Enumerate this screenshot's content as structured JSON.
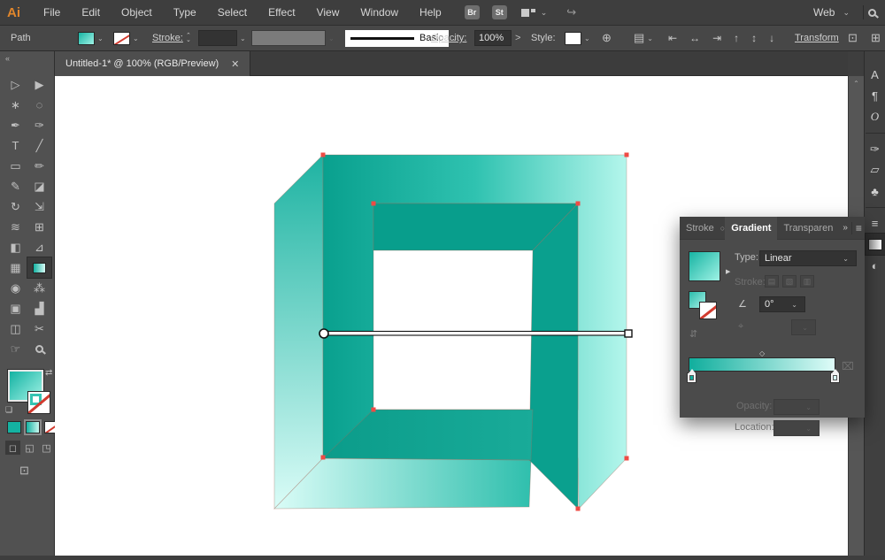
{
  "menubar": {
    "logo": "Ai",
    "items": [
      "File",
      "Edit",
      "Object",
      "Type",
      "Select",
      "Effect",
      "View",
      "Window",
      "Help"
    ],
    "br_label": "Br",
    "st_label": "St",
    "workspace": "Web"
  },
  "controlbar": {
    "path_label": "Path",
    "stroke_label": "Stroke:",
    "stroke_style_value": "Basic",
    "opacity_label": "Opacity:",
    "opacity_value": "100%",
    "opacity_arrow": ">",
    "style_label": "Style:",
    "transform_label": "Transform",
    "align_icons": [
      {
        "name": "align-left-icon",
        "glyph": "⇤"
      },
      {
        "name": "align-center-h-icon",
        "glyph": "↔"
      },
      {
        "name": "align-right-icon",
        "glyph": "⇥"
      },
      {
        "name": "align-top-icon",
        "glyph": "↑"
      },
      {
        "name": "align-middle-v-icon",
        "glyph": "↕"
      },
      {
        "name": "align-bottom-icon",
        "glyph": "↓"
      }
    ]
  },
  "tab": {
    "title": "Untitled-1* @ 100% (RGB/Preview)",
    "close_glyph": "✕"
  },
  "toolbar": {
    "collapse_glyph": "«",
    "tools": [
      {
        "name": "tool-direct-selection",
        "glyph": "▷"
      },
      {
        "name": "tool-selection",
        "glyph": "▶"
      },
      {
        "name": "tool-magic-wand",
        "glyph": "∗"
      },
      {
        "name": "tool-lasso",
        "glyph": "◌"
      },
      {
        "name": "tool-pen",
        "glyph": "✒"
      },
      {
        "name": "tool-curvature",
        "glyph": "✑"
      },
      {
        "name": "tool-type",
        "glyph": "T"
      },
      {
        "name": "tool-line-segment",
        "glyph": "╱"
      },
      {
        "name": "tool-rectangle",
        "glyph": "▭"
      },
      {
        "name": "tool-paintbrush",
        "glyph": "✏"
      },
      {
        "name": "tool-pencil",
        "glyph": "✎"
      },
      {
        "name": "tool-eraser",
        "glyph": "◪"
      },
      {
        "name": "tool-rotate",
        "glyph": "↻"
      },
      {
        "name": "tool-scale",
        "glyph": "⇲"
      },
      {
        "name": "tool-width",
        "glyph": "≋"
      },
      {
        "name": "tool-free-transform",
        "glyph": "⊞"
      },
      {
        "name": "tool-shape-builder",
        "glyph": "◧"
      },
      {
        "name": "tool-perspective-grid",
        "glyph": "⊿"
      },
      {
        "name": "tool-mesh",
        "glyph": "▦"
      },
      {
        "name": "tool-gradient",
        "glyph": "",
        "cls": "grad-tool",
        "selected": true
      },
      {
        "name": "tool-eyedropper",
        "glyph": "◉"
      },
      {
        "name": "tool-blend",
        "glyph": "⁂"
      },
      {
        "name": "tool-artboard",
        "glyph": "▣"
      },
      {
        "name": "tool-graph",
        "glyph": "▟"
      },
      {
        "name": "tool-slice",
        "glyph": "◫"
      },
      {
        "name": "tool-knife",
        "glyph": "✂"
      },
      {
        "name": "tool-hand",
        "glyph": "☞"
      },
      {
        "name": "tool-zoom",
        "glyph": "",
        "cls": "mag-tool"
      }
    ],
    "swap_glyph": "⇄",
    "default_swatches_glyph": "❏",
    "draw_modes": [
      {
        "name": "draw-normal-button",
        "glyph": "◻",
        "selected": true
      },
      {
        "name": "draw-behind-button",
        "glyph": "◱"
      },
      {
        "name": "draw-inside-button",
        "glyph": "◳"
      }
    ],
    "screen_mode_glyph": "⊡"
  },
  "dock": {
    "icons": [
      {
        "name": "panel-icon-character",
        "glyph": "A"
      },
      {
        "name": "panel-icon-paragraph",
        "glyph": "¶"
      },
      {
        "name": "panel-icon-opentype",
        "glyph": "O",
        "cls": "italic"
      },
      {
        "name": "panel-icon-brushes",
        "glyph": "✑",
        "cls": "sep-above"
      },
      {
        "name": "panel-icon-symbols",
        "glyph": "▱"
      },
      {
        "name": "panel-icon-swatches",
        "glyph": "♣"
      },
      {
        "name": "panel-icon-stroke",
        "glyph": "≡",
        "cls": "sep-above"
      },
      {
        "name": "panel-icon-gradient",
        "glyph": "",
        "cls": "grad-icon",
        "selected": true
      },
      {
        "name": "panel-icon-transparency",
        "glyph": "◐"
      }
    ]
  },
  "panel": {
    "tab_stroke": "Stroke",
    "tab_gradient": "Gradient",
    "tab_transparency": "Transparen",
    "circle_glyph": "○",
    "collapse_glyph": "»",
    "menu_glyph": "≡",
    "type_label": "Type:",
    "type_value": "Linear",
    "stroke_label": "Stroke:",
    "angle_glyph": "∠",
    "angle_value": "0°",
    "annotator_glyph": "⌖",
    "reverse_glyph": "⇵",
    "diamond_glyph": "◇",
    "trash_glyph": "⌧",
    "opacity_label": "Opacity:",
    "location_label": "Location:"
  },
  "colors": {
    "gradient_start": "#09A08E",
    "gradient_mid": "#2FC2B0",
    "gradient_end": "#B4F6EC",
    "left_face_top": "#1EB3A2",
    "left_face_bottom": "#DAFCF7",
    "bottom_face_left": "#DAFCF7",
    "bottom_face_right": "#2FBFAD",
    "bevel_left": "#0B9C8A",
    "bevel_right": "#19AB99",
    "ceiling": "#089E8C",
    "wall": "#0AA08E",
    "anchor_red": "#EF4B45"
  }
}
